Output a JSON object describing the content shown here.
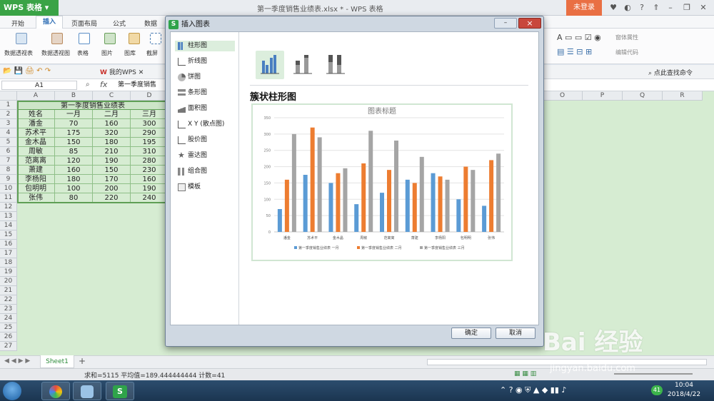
{
  "app": {
    "name": "WPS 表格",
    "doc_title": "第一季度销售业绩表.xlsx * - WPS 表格",
    "login": "未登录"
  },
  "menus": [
    "开始",
    "插入",
    "页面布局",
    "公式",
    "数据"
  ],
  "ribbon": {
    "items": [
      "数据透视表",
      "数据透视图",
      "表格",
      "图片",
      "图库",
      "截屏"
    ],
    "right_items": [
      "窗体属性",
      "编辑代码"
    ]
  },
  "qat": {
    "my_wps": "我的WPS",
    "find_cmd": "点此查找命令"
  },
  "formula": {
    "cell": "A1",
    "fx": "fx",
    "content": "第一季度销售"
  },
  "sheet": {
    "columns": [
      "A",
      "B",
      "C",
      "D",
      "O",
      "P",
      "Q",
      "R"
    ],
    "row_numbers": [
      "1",
      "2",
      "3",
      "4",
      "5",
      "6",
      "7",
      "8",
      "9",
      "10",
      "11",
      "12",
      "13",
      "14",
      "15",
      "16",
      "17",
      "18",
      "19",
      "20",
      "21",
      "22",
      "23",
      "24",
      "25",
      "26",
      "27"
    ],
    "title": "第一季度销售业绩表",
    "header": [
      "姓名",
      "一月",
      "二月",
      "三月"
    ],
    "rows": [
      [
        "潘金",
        "70",
        "160",
        "300"
      ],
      [
        "苏术平",
        "175",
        "320",
        "290"
      ],
      [
        "金木晶",
        "150",
        "180",
        "195"
      ],
      [
        "周敏",
        "85",
        "210",
        "310"
      ],
      [
        "范离离",
        "120",
        "190",
        "280"
      ],
      [
        "萧建",
        "160",
        "150",
        "230"
      ],
      [
        "李杨阳",
        "180",
        "170",
        "160"
      ],
      [
        "包明明",
        "100",
        "200",
        "190"
      ],
      [
        "张伟",
        "80",
        "220",
        "240"
      ]
    ]
  },
  "tabs": {
    "sheet": "Sheet1",
    "add": "+"
  },
  "status": {
    "text": "求和=5115  平均值=189.444444444  计数=41"
  },
  "dialog": {
    "title": "插入图表",
    "close": "×",
    "categories": [
      "柱形图",
      "折线图",
      "饼图",
      "条形图",
      "面积图",
      "X Y (散点图)",
      "股价图",
      "雷达图",
      "组合图",
      "模板"
    ],
    "selected_subtype": "簇状柱形图",
    "ok": "确定",
    "cancel": "取消"
  },
  "chart_data": {
    "type": "bar",
    "title": "图表标题",
    "categories": [
      "潘金",
      "苏术平",
      "金木晶",
      "周敏",
      "范离离",
      "萧建",
      "李杨阳",
      "包明明",
      "张伟"
    ],
    "series": [
      {
        "name": "第一季度销售业绩表 一月",
        "values": [
          70,
          175,
          150,
          85,
          120,
          160,
          180,
          100,
          80
        ]
      },
      {
        "name": "第一季度销售业绩表 二月",
        "values": [
          160,
          320,
          180,
          210,
          190,
          150,
          170,
          200,
          220
        ]
      },
      {
        "name": "第一季度销售业绩表 三月",
        "values": [
          300,
          290,
          195,
          310,
          280,
          230,
          160,
          190,
          240
        ]
      }
    ],
    "yticks": [
      "0",
      "50",
      "100",
      "150",
      "200",
      "250",
      "300",
      "350"
    ],
    "ylim": [
      0,
      350
    ],
    "colors": [
      "#5b9bd5",
      "#ed7d31",
      "#a5a5a5"
    ],
    "grid": true,
    "legend": "bottom"
  },
  "taskbar": {
    "time": "10:04",
    "date": "2018/4/22"
  },
  "watermark": {
    "brand": "Bai 经验",
    "url": "jingyan.baidu.com"
  },
  "colors": {
    "accent": "#3aa346",
    "login": "#e96f43",
    "selection": "#d6ecd2"
  }
}
